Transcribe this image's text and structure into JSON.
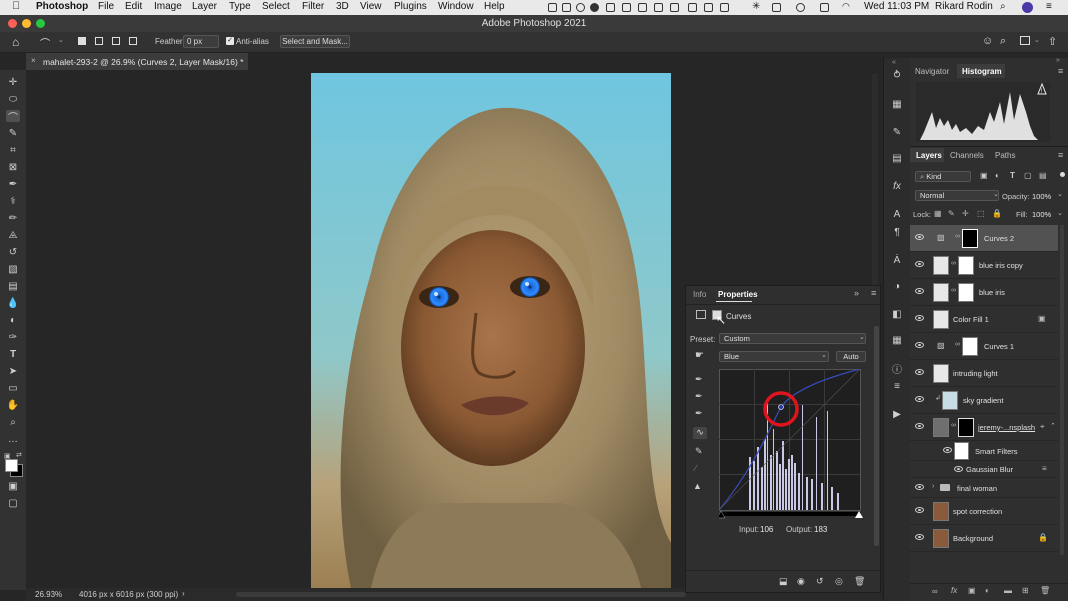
{
  "menubar": {
    "app": "Photoshop",
    "menus": [
      "File",
      "Edit",
      "Image",
      "Layer",
      "Type",
      "Select",
      "Filter",
      "3D",
      "View",
      "Plugins",
      "Window",
      "Help"
    ],
    "clock": "Wed 11:03 PM",
    "user": "Rikard Rodin"
  },
  "window": {
    "title": "Adobe Photoshop 2021"
  },
  "options": {
    "feather_label": "Feather:",
    "feather_value": "0 px",
    "antialias_label": "Anti-alias",
    "select_mask_label": "Select and Mask..."
  },
  "document": {
    "tab_title": "mahalet-293-2 @ 26.9% (Curves 2, Layer Mask/16) *",
    "zoom": "26.93%",
    "dimensions": "4016 px x 6016 px (300 ppi)"
  },
  "properties": {
    "tabs": [
      "Info",
      "Properties"
    ],
    "active_tab": "Properties",
    "adjustment": "Curves",
    "preset_label": "Preset:",
    "preset_value": "Custom",
    "channel": "Blue",
    "auto_label": "Auto",
    "input_label": "Input:",
    "input_value": "106",
    "output_label": "Output:",
    "output_value": "183"
  },
  "nav_panel": {
    "tabs": [
      "Navigator",
      "Histogram"
    ],
    "active": "Histogram"
  },
  "layers_panel": {
    "tabs": [
      "Layers",
      "Channels",
      "Paths"
    ],
    "active": "Layers",
    "kind_label": "Kind",
    "blend_mode": "Normal",
    "opacity_label": "Opacity:",
    "opacity_value": "100%",
    "lock_label": "Lock:",
    "fill_label": "Fill:",
    "fill_value": "100%",
    "layers": [
      {
        "name": "Curves 2"
      },
      {
        "name": "blue iris copy"
      },
      {
        "name": "blue iris"
      },
      {
        "name": "Color Fill 1"
      },
      {
        "name": "Curves 1"
      },
      {
        "name": "intruding light"
      },
      {
        "name": "sky gradient"
      },
      {
        "name": "jeremy-...nsplash"
      },
      {
        "name": "Smart Filters"
      },
      {
        "name": "Gaussian Blur"
      },
      {
        "name": "final woman"
      },
      {
        "name": "spot correction"
      },
      {
        "name": "Background"
      }
    ]
  },
  "colors": {
    "accent": "#1473e6",
    "highlight_ring": "#e0141e",
    "sky": "#7ccde5"
  }
}
